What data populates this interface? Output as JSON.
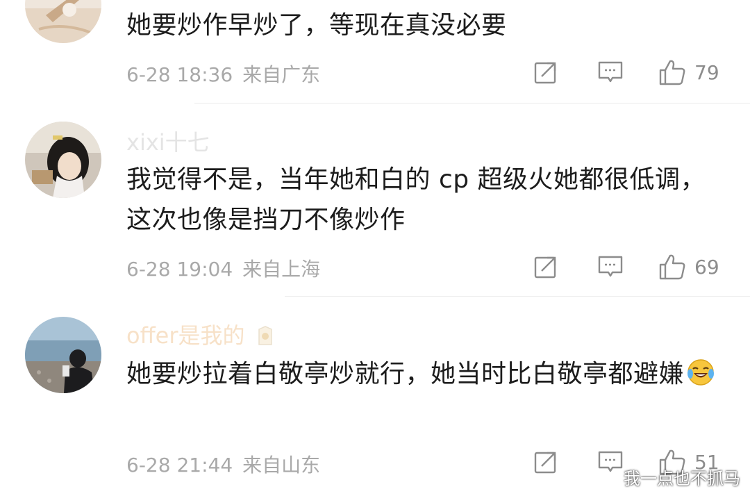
{
  "comments": [
    {
      "username": "",
      "text": "她要炒作早炒了，等现在真没必要",
      "date": "6-28 18:36",
      "location": "来自广东",
      "likes": "79",
      "avatar_icon": "avatar-photo"
    },
    {
      "username": "xixi十七",
      "text": "我觉得不是，当年她和白的 cp 超级火她都很低调，这次也像是挡刀不像炒作",
      "date": "6-28 19:04",
      "location": "来自上海",
      "likes": "69",
      "avatar_icon": "avatar-photo"
    },
    {
      "username": "offer是我的",
      "text": "她要炒拉着白敬亭炒就行，她当时比白敬亭都避嫌",
      "date": "6-28 21:44",
      "location": "来自山东",
      "likes": "51",
      "avatar_icon": "avatar-photo",
      "emoji_icon": "laughing-tears-emoji-icon"
    }
  ],
  "watermark": "我一点也不抓马",
  "colors": {
    "text": "#1c1c1c",
    "meta": "#a9a9a9",
    "icon": "#8c8c8c",
    "divider": "#ececec"
  }
}
